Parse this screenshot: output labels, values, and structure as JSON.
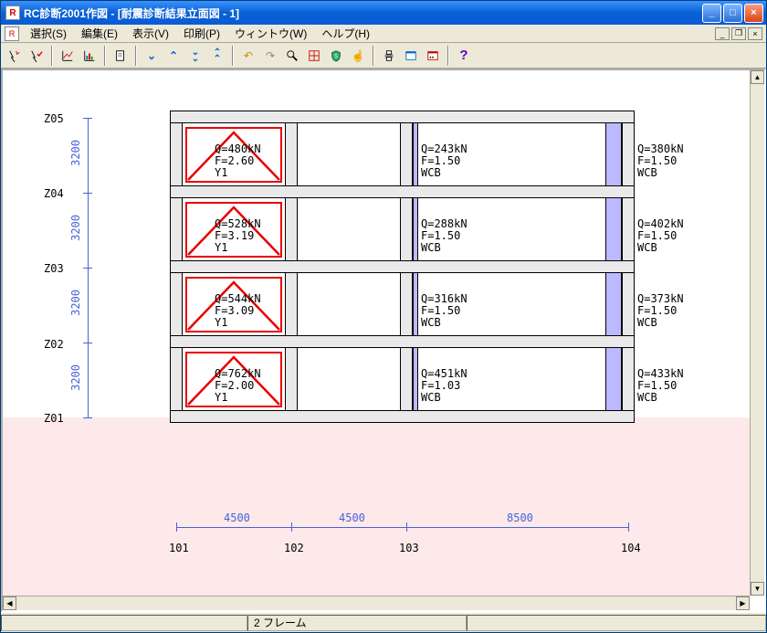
{
  "window": {
    "title": "RC診断2001作図 - [耐震診断結果立面図 - 1]"
  },
  "menu": {
    "select": "選択(S)",
    "edit": "編集(E)",
    "view": "表示(V)",
    "print": "印刷(P)",
    "window": "ウィントウ(W)",
    "help": "ヘルプ(H)"
  },
  "toolbar": {
    "t1": "",
    "t2": "",
    "t3": "",
    "t4": "",
    "t5": "",
    "t6": "",
    "t7": "",
    "t8": "",
    "t9": "",
    "t10": "",
    "t11": "",
    "t12": "",
    "t13": "",
    "t14": "",
    "t15": "",
    "t16": "",
    "t17": "",
    "t18": "",
    "t19": "",
    "t20": "",
    "t21": ""
  },
  "status": {
    "frame": "2 フレーム"
  },
  "axes": {
    "z_labels": [
      "Z05",
      "Z04",
      "Z03",
      "Z02",
      "Z01"
    ],
    "col_labels": [
      "101",
      "102",
      "103",
      "104"
    ],
    "floor_heights": [
      "3200",
      "3200",
      "3200",
      "3200"
    ],
    "span_widths": [
      "4500",
      "4500",
      "8500"
    ]
  },
  "chart_data": {
    "type": "table",
    "title": "耐震診断結果立面図",
    "floor_height_mm": 3200,
    "spans_mm": [
      4500,
      4500,
      8500
    ],
    "z_levels": [
      "Z01",
      "Z02",
      "Z03",
      "Z04",
      "Z05"
    ],
    "column_lines": [
      "101",
      "102",
      "103",
      "104"
    ],
    "cells": [
      {
        "floor": "Z04-Z05",
        "span": "101-102",
        "Q_kN": 480,
        "F": 2.6,
        "mode": "Y1",
        "style": "red"
      },
      {
        "floor": "Z04-Z05",
        "span": "103-104",
        "Q_kN": 243,
        "F": 1.5,
        "mode": "WCB",
        "style": "blue"
      },
      {
        "floor": "Z04-Z05",
        "right_of": "104",
        "Q_kN": 380,
        "F": 1.5,
        "mode": "WCB",
        "style": "blue"
      },
      {
        "floor": "Z03-Z04",
        "span": "101-102",
        "Q_kN": 528,
        "F": 3.19,
        "mode": "Y1",
        "style": "red"
      },
      {
        "floor": "Z03-Z04",
        "span": "103-104",
        "Q_kN": 288,
        "F": 1.5,
        "mode": "WCB",
        "style": "blue"
      },
      {
        "floor": "Z03-Z04",
        "right_of": "104",
        "Q_kN": 402,
        "F": 1.5,
        "mode": "WCB",
        "style": "blue"
      },
      {
        "floor": "Z02-Z03",
        "span": "101-102",
        "Q_kN": 544,
        "F": 3.09,
        "mode": "Y1",
        "style": "red"
      },
      {
        "floor": "Z02-Z03",
        "span": "103-104",
        "Q_kN": 316,
        "F": 1.5,
        "mode": "WCB",
        "style": "blue"
      },
      {
        "floor": "Z02-Z03",
        "right_of": "104",
        "Q_kN": 373,
        "F": 1.5,
        "mode": "WCB",
        "style": "blue"
      },
      {
        "floor": "Z01-Z02",
        "span": "101-102",
        "Q_kN": 762,
        "F": 2.0,
        "mode": "Y1",
        "style": "red"
      },
      {
        "floor": "Z01-Z02",
        "span": "103-104",
        "Q_kN": 451,
        "F": 1.03,
        "mode": "WCB",
        "style": "blue"
      },
      {
        "floor": "Z01-Z02",
        "right_of": "104",
        "Q_kN": 433,
        "F": 1.5,
        "mode": "WCB",
        "style": "blue"
      }
    ]
  },
  "display": {
    "cell_r0_c0": "Q=480kN\nF=2.60\nY1",
    "cell_r0_c2": "Q=243kN\nF=1.50\nWCB",
    "cell_r0_c3": "Q=380kN\nF=1.50\nWCB",
    "cell_r1_c0": "Q=528kN\nF=3.19\nY1",
    "cell_r1_c2": "Q=288kN\nF=1.50\nWCB",
    "cell_r1_c3": "Q=402kN\nF=1.50\nWCB",
    "cell_r2_c0": "Q=544kN\nF=3.09\nY1",
    "cell_r2_c2": "Q=316kN\nF=1.50\nWCB",
    "cell_r2_c3": "Q=373kN\nF=1.50\nWCB",
    "cell_r3_c0": "Q=762kN\nF=2.00\nY1",
    "cell_r3_c2": "Q=451kN\nF=1.03\nWCB",
    "cell_r3_c3": "Q=433kN\nF=1.50\nWCB"
  }
}
